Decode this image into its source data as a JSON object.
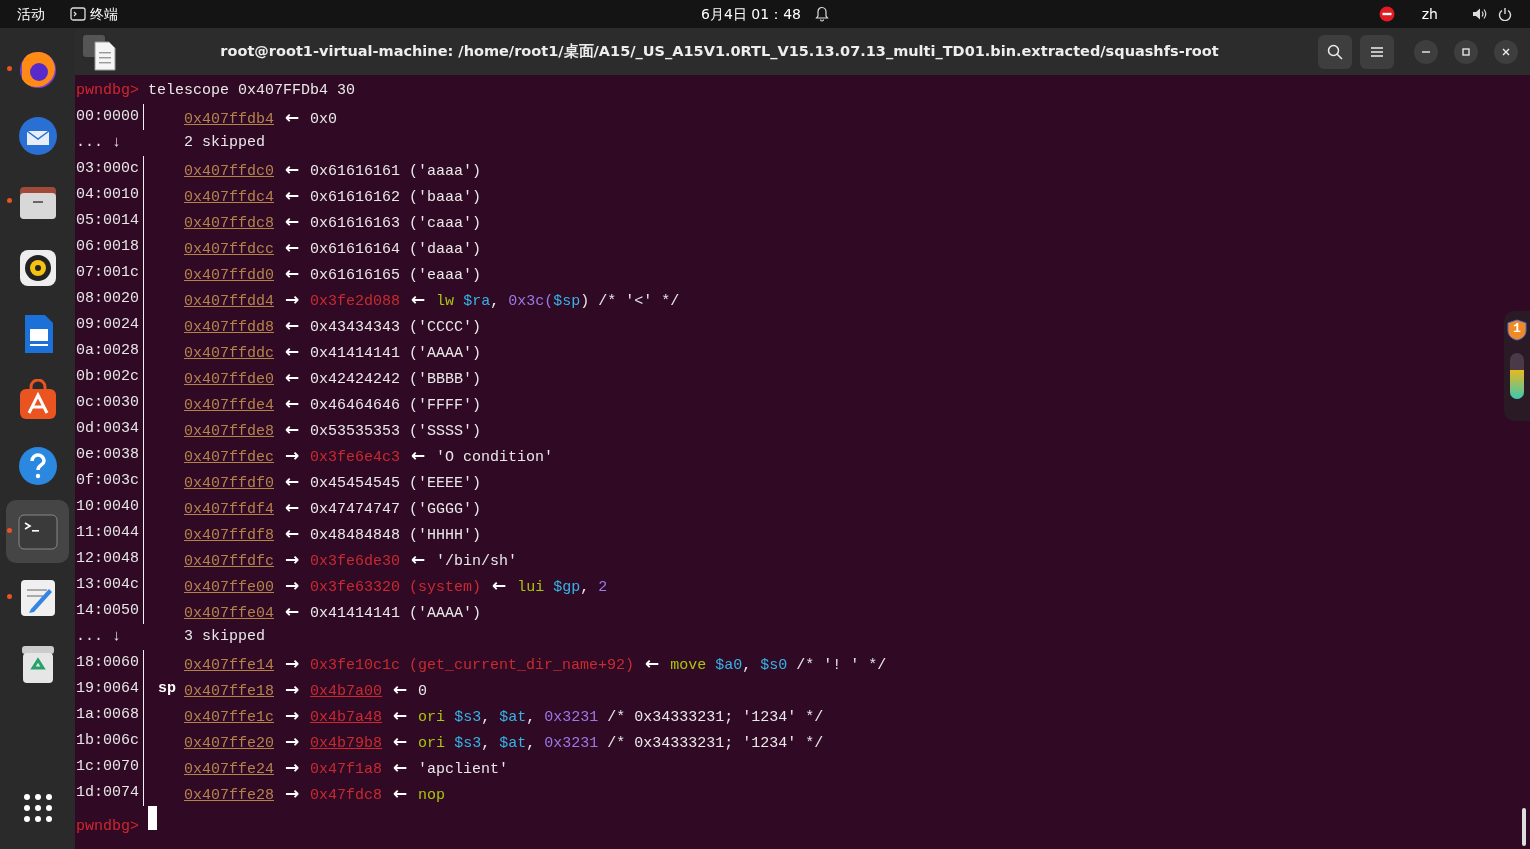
{
  "top_bar": {
    "activities": "活动",
    "app_name": "终端",
    "clock": "6月4日 01：48",
    "language": "zh"
  },
  "dock": {
    "items": [
      {
        "kind": "globe",
        "running": true,
        "selected": false
      },
      {
        "kind": "mail",
        "running": false,
        "selected": false
      },
      {
        "kind": "folder",
        "running": true,
        "selected": false
      },
      {
        "kind": "speaker",
        "running": false,
        "selected": false
      },
      {
        "kind": "document",
        "running": false,
        "selected": false
      },
      {
        "kind": "bag",
        "running": false,
        "selected": false
      },
      {
        "kind": "help",
        "running": false,
        "selected": false
      },
      {
        "kind": "terminal",
        "running": true,
        "selected": true
      },
      {
        "kind": "editor",
        "running": true,
        "selected": false
      },
      {
        "kind": "trash",
        "running": false,
        "selected": false
      }
    ]
  },
  "window": {
    "title": "root@root1-virtual-machine: /home/root1/桌面/A15/_US_A15V1.0RTL_V15.13.07.13_multi_TD01.bin.extracted/squashfs-root"
  },
  "terminal": {
    "lines": [
      {
        "kind": "command",
        "prompt": "pwndbg>",
        "text": "telescope 0x407FFDb4 30"
      },
      {
        "kind": "entry",
        "offset": "00:0000",
        "segments": [
          {
            "kind": "addr",
            "text": "0x407ffdb4"
          },
          {
            "kind": "arrow",
            "text": "←"
          },
          {
            "kind": "text",
            "text": "0x0"
          }
        ]
      },
      {
        "kind": "skip",
        "offset": "... ↓",
        "text": "2 skipped"
      },
      {
        "kind": "entry",
        "offset": "03:000c",
        "segments": [
          {
            "kind": "addr",
            "text": "0x407ffdc0"
          },
          {
            "kind": "arrow",
            "text": "←"
          },
          {
            "kind": "text",
            "text": "0x61616161"
          },
          {
            "kind": "text",
            "text": "('aaaa')"
          }
        ]
      },
      {
        "kind": "entry",
        "offset": "04:0010",
        "segments": [
          {
            "kind": "addr",
            "text": "0x407ffdc4"
          },
          {
            "kind": "arrow",
            "text": "←"
          },
          {
            "kind": "text",
            "text": "0x61616162"
          },
          {
            "kind": "text",
            "text": "('baaa')"
          }
        ]
      },
      {
        "kind": "entry",
        "offset": "05:0014",
        "segments": [
          {
            "kind": "addr",
            "text": "0x407ffdc8"
          },
          {
            "kind": "arrow",
            "text": "←"
          },
          {
            "kind": "text",
            "text": "0x61616163"
          },
          {
            "kind": "text",
            "text": "('caaa')"
          }
        ]
      },
      {
        "kind": "entry",
        "offset": "06:0018",
        "segments": [
          {
            "kind": "addr",
            "text": "0x407ffdcc"
          },
          {
            "kind": "arrow",
            "text": "←"
          },
          {
            "kind": "text",
            "text": "0x61616164"
          },
          {
            "kind": "text",
            "text": "('daaa')"
          }
        ]
      },
      {
        "kind": "entry",
        "offset": "07:001c",
        "segments": [
          {
            "kind": "addr",
            "text": "0x407ffdd0"
          },
          {
            "kind": "arrow",
            "text": "←"
          },
          {
            "kind": "text",
            "text": "0x61616165"
          },
          {
            "kind": "text",
            "text": "('eaaa')"
          }
        ]
      },
      {
        "kind": "entry",
        "offset": "08:0020",
        "segments": [
          {
            "kind": "addr",
            "text": "0x407ffdd4"
          },
          {
            "kind": "arrow",
            "text": "→"
          },
          {
            "kind": "red",
            "text": "0x3fe2d088"
          },
          {
            "kind": "arrow",
            "text": "←"
          },
          {
            "kind": "op",
            "text": "lw"
          },
          {
            "kind": "reg",
            "text": "$ra"
          },
          {
            "kind": "text",
            "text": ",",
            "tight": true
          },
          {
            "kind": "num",
            "text": "0x3c("
          },
          {
            "kind": "reg",
            "text": "$sp",
            "tight": true
          },
          {
            "kind": "text",
            "text": ")",
            "tight": true
          },
          {
            "kind": "text",
            "text": "/* '<' */"
          }
        ]
      },
      {
        "kind": "entry",
        "offset": "09:0024",
        "segments": [
          {
            "kind": "addr",
            "text": "0x407ffdd8"
          },
          {
            "kind": "arrow",
            "text": "←"
          },
          {
            "kind": "text",
            "text": "0x43434343"
          },
          {
            "kind": "text",
            "text": "('CCCC')"
          }
        ]
      },
      {
        "kind": "entry",
        "offset": "0a:0028",
        "segments": [
          {
            "kind": "addr",
            "text": "0x407ffddc"
          },
          {
            "kind": "arrow",
            "text": "←"
          },
          {
            "kind": "text",
            "text": "0x41414141"
          },
          {
            "kind": "text",
            "text": "('AAAA')"
          }
        ]
      },
      {
        "kind": "entry",
        "offset": "0b:002c",
        "segments": [
          {
            "kind": "addr",
            "text": "0x407ffde0"
          },
          {
            "kind": "arrow",
            "text": "←"
          },
          {
            "kind": "text",
            "text": "0x42424242"
          },
          {
            "kind": "text",
            "text": "('BBBB')"
          }
        ]
      },
      {
        "kind": "entry",
        "offset": "0c:0030",
        "segments": [
          {
            "kind": "addr",
            "text": "0x407ffde4"
          },
          {
            "kind": "arrow",
            "text": "←"
          },
          {
            "kind": "text",
            "text": "0x46464646"
          },
          {
            "kind": "text",
            "text": "('FFFF')"
          }
        ]
      },
      {
        "kind": "entry",
        "offset": "0d:0034",
        "segments": [
          {
            "kind": "addr",
            "text": "0x407ffde8"
          },
          {
            "kind": "arrow",
            "text": "←"
          },
          {
            "kind": "text",
            "text": "0x53535353"
          },
          {
            "kind": "text",
            "text": "('SSSS')"
          }
        ]
      },
      {
        "kind": "entry",
        "offset": "0e:0038",
        "segments": [
          {
            "kind": "addr",
            "text": "0x407ffdec"
          },
          {
            "kind": "arrow",
            "text": "→"
          },
          {
            "kind": "red",
            "text": "0x3fe6e4c3"
          },
          {
            "kind": "arrow",
            "text": "←"
          },
          {
            "kind": "text",
            "text": "'O condition'"
          }
        ]
      },
      {
        "kind": "entry",
        "offset": "0f:003c",
        "segments": [
          {
            "kind": "addr",
            "text": "0x407ffdf0"
          },
          {
            "kind": "arrow",
            "text": "←"
          },
          {
            "kind": "text",
            "text": "0x45454545"
          },
          {
            "kind": "text",
            "text": "('EEEE')"
          }
        ]
      },
      {
        "kind": "entry",
        "offset": "10:0040",
        "segments": [
          {
            "kind": "addr",
            "text": "0x407ffdf4"
          },
          {
            "kind": "arrow",
            "text": "←"
          },
          {
            "kind": "text",
            "text": "0x47474747"
          },
          {
            "kind": "text",
            "text": "('GGGG')"
          }
        ]
      },
      {
        "kind": "entry",
        "offset": "11:0044",
        "segments": [
          {
            "kind": "addr",
            "text": "0x407ffdf8"
          },
          {
            "kind": "arrow",
            "text": "←"
          },
          {
            "kind": "text",
            "text": "0x48484848"
          },
          {
            "kind": "text",
            "text": "('HHHH')"
          }
        ]
      },
      {
        "kind": "entry",
        "offset": "12:0048",
        "segments": [
          {
            "kind": "addr",
            "text": "0x407ffdfc"
          },
          {
            "kind": "arrow",
            "text": "→"
          },
          {
            "kind": "red",
            "text": "0x3fe6de30"
          },
          {
            "kind": "arrow",
            "text": "←"
          },
          {
            "kind": "text",
            "text": "'/bin/sh'"
          }
        ]
      },
      {
        "kind": "entry",
        "offset": "13:004c",
        "segments": [
          {
            "kind": "addr",
            "text": "0x407ffe00"
          },
          {
            "kind": "arrow",
            "text": "→"
          },
          {
            "kind": "red",
            "text": "0x3fe63320"
          },
          {
            "kind": "red",
            "text": "(system)"
          },
          {
            "kind": "arrow",
            "text": "←"
          },
          {
            "kind": "op",
            "text": "lui"
          },
          {
            "kind": "reg",
            "text": "$gp"
          },
          {
            "kind": "text",
            "text": ",",
            "tight": true
          },
          {
            "kind": "num",
            "text": "2"
          }
        ]
      },
      {
        "kind": "entry",
        "offset": "14:0050",
        "segments": [
          {
            "kind": "addr",
            "text": "0x407ffe04"
          },
          {
            "kind": "arrow",
            "text": "←"
          },
          {
            "kind": "text",
            "text": "0x41414141"
          },
          {
            "kind": "text",
            "text": "('AAAA')"
          }
        ]
      },
      {
        "kind": "skip",
        "offset": "... ↓",
        "text": "3 skipped"
      },
      {
        "kind": "entry",
        "offset": "18:0060",
        "segments": [
          {
            "kind": "addr",
            "text": "0x407ffe14"
          },
          {
            "kind": "arrow",
            "text": "→"
          },
          {
            "kind": "red",
            "text": "0x3fe10c1c"
          },
          {
            "kind": "red",
            "text": "(get_current_dir_name+92)"
          },
          {
            "kind": "arrow",
            "text": "←"
          },
          {
            "kind": "op",
            "text": "move"
          },
          {
            "kind": "reg",
            "text": "$a0"
          },
          {
            "kind": "text",
            "text": ",",
            "tight": true
          },
          {
            "kind": "reg",
            "text": "$s0"
          },
          {
            "kind": "text",
            "text": "/* '! ' */"
          }
        ]
      },
      {
        "kind": "entry",
        "offset": "19:0064",
        "tag": "sp",
        "segments": [
          {
            "kind": "addr",
            "text": "0x407ffe18"
          },
          {
            "kind": "arrow",
            "text": "→"
          },
          {
            "kind": "link",
            "text": "0x4b7a00"
          },
          {
            "kind": "arrow",
            "text": "←"
          },
          {
            "kind": "text",
            "text": "0"
          }
        ]
      },
      {
        "kind": "entry",
        "offset": "1a:0068",
        "segments": [
          {
            "kind": "addr",
            "text": "0x407ffe1c"
          },
          {
            "kind": "arrow",
            "text": "→"
          },
          {
            "kind": "link",
            "text": "0x4b7a48"
          },
          {
            "kind": "arrow",
            "text": "←"
          },
          {
            "kind": "op",
            "text": "ori"
          },
          {
            "kind": "reg",
            "text": "$s3"
          },
          {
            "kind": "text",
            "text": ",",
            "tight": true
          },
          {
            "kind": "reg",
            "text": "$at"
          },
          {
            "kind": "text",
            "text": ",",
            "tight": true
          },
          {
            "kind": "num",
            "text": "0x3231"
          },
          {
            "kind": "text",
            "text": "/* 0x34333231; '1234' */"
          }
        ]
      },
      {
        "kind": "entry",
        "offset": "1b:006c",
        "segments": [
          {
            "kind": "addr",
            "text": "0x407ffe20"
          },
          {
            "kind": "arrow",
            "text": "→"
          },
          {
            "kind": "link",
            "text": "0x4b79b8"
          },
          {
            "kind": "arrow",
            "text": "←"
          },
          {
            "kind": "op",
            "text": "ori"
          },
          {
            "kind": "reg",
            "text": "$s3"
          },
          {
            "kind": "text",
            "text": ",",
            "tight": true
          },
          {
            "kind": "reg",
            "text": "$at"
          },
          {
            "kind": "text",
            "text": ",",
            "tight": true
          },
          {
            "kind": "num",
            "text": "0x3231"
          },
          {
            "kind": "text",
            "text": "/* 0x34333231; '1234' */"
          }
        ]
      },
      {
        "kind": "entry",
        "offset": "1c:0070",
        "segments": [
          {
            "kind": "addr",
            "text": "0x407ffe24"
          },
          {
            "kind": "arrow",
            "text": "→"
          },
          {
            "kind": "red",
            "text": "0x47f1a8"
          },
          {
            "kind": "arrow",
            "text": "←"
          },
          {
            "kind": "text",
            "text": "'apclient'"
          }
        ]
      },
      {
        "kind": "entry",
        "offset": "1d:0074",
        "segments": [
          {
            "kind": "addr",
            "text": "0x407ffe28"
          },
          {
            "kind": "arrow",
            "text": "→"
          },
          {
            "kind": "red",
            "text": "0x47fdc8"
          },
          {
            "kind": "arrow",
            "text": "←"
          },
          {
            "kind": "op",
            "text": "nop"
          }
        ]
      },
      {
        "kind": "prompt",
        "prompt": "pwndbg>",
        "cursor": true
      }
    ]
  },
  "side_widget": {
    "badge": "1",
    "level": 0.62
  }
}
